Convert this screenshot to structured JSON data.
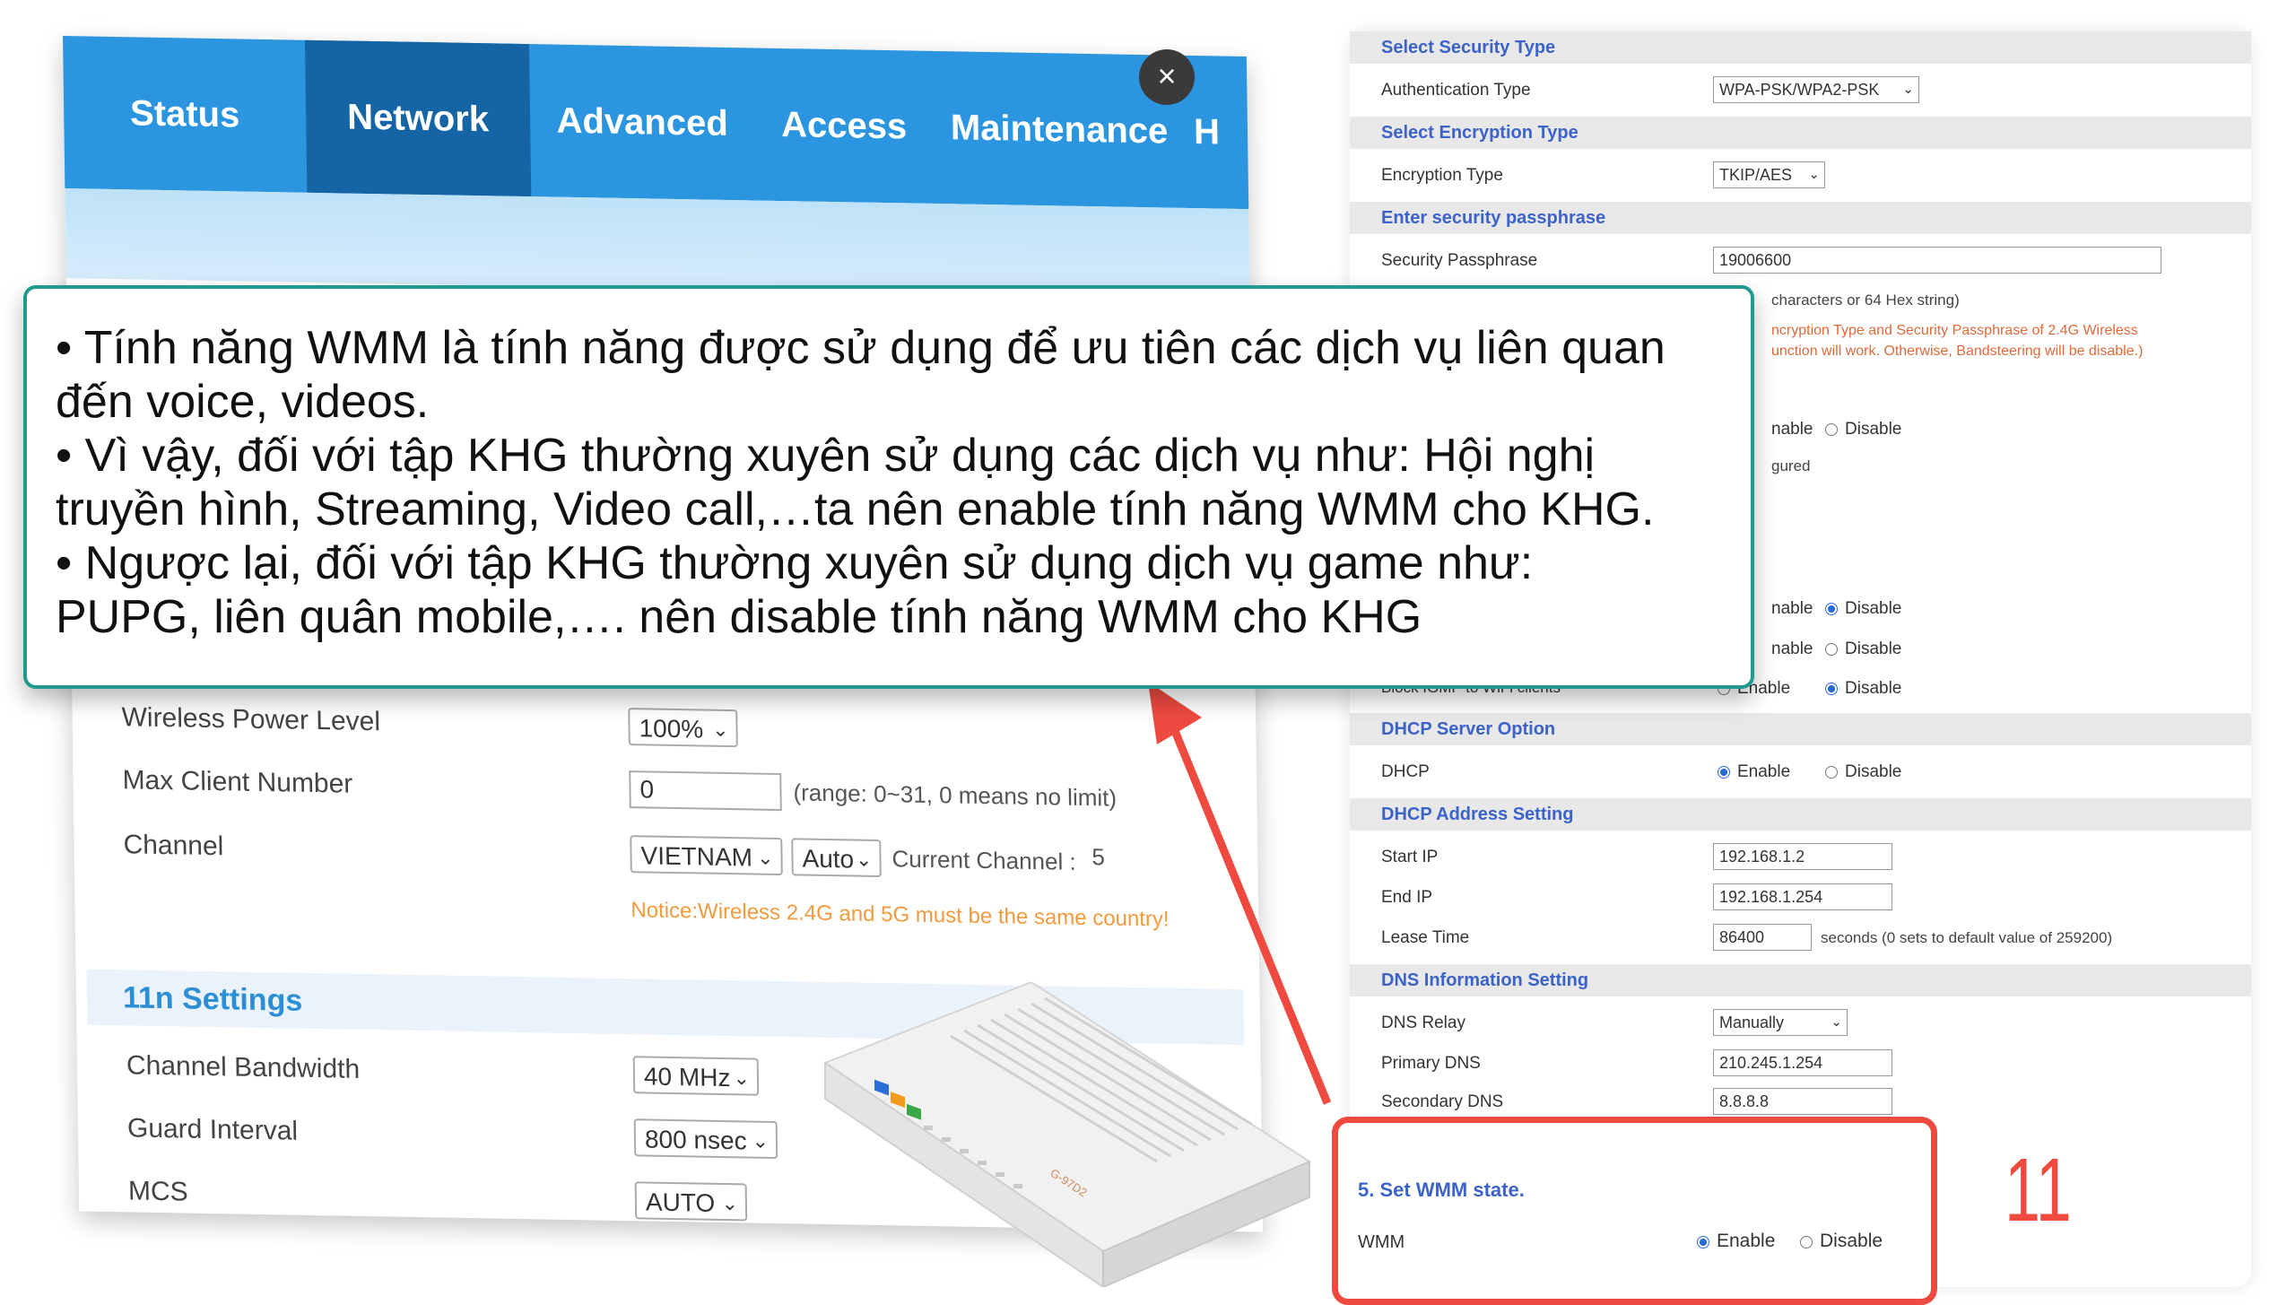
{
  "router_ui": {
    "nav_tabs": [
      {
        "label": "Status"
      },
      {
        "label": "Network"
      },
      {
        "label": "Advanced"
      },
      {
        "label": "Access"
      },
      {
        "label": "Maintenance"
      },
      {
        "label": "H"
      }
    ],
    "active_tab": "Network",
    "wireless_power_level": {
      "label": "Wireless Power Level",
      "value": "100%"
    },
    "max_client_number": {
      "label": "Max Client Number",
      "value": "0",
      "hint": "(range: 0~31, 0 means no limit)"
    },
    "channel": {
      "label": "Channel",
      "country": "VIETNAM",
      "mode": "Auto",
      "current_label": "Current Channel :",
      "current_value": "5",
      "notice": "Notice:Wireless 2.4G and 5G must be the same country!"
    },
    "section_11n": "11n Settings",
    "channel_bandwidth": {
      "label": "Channel Bandwidth",
      "value": "40 MHz"
    },
    "guard_interval": {
      "label": "Guard Interval",
      "value": "800 nsec"
    },
    "mcs": {
      "label": "MCS",
      "value": "AUTO"
    }
  },
  "callout": {
    "lines": [
      "• Tính năng WMM là tính năng được sử dụng để ưu tiên các dịch vụ liên quan",
      "đến voice, videos.",
      "• Vì vậy, đối với tập KHG thường xuyên sử dụng các dịch vụ như: Hội nghị",
      "truyền hình, Streaming, Video call,…ta nên enable tính năng WMM cho KHG.",
      "• Ngược lại, đối với tập KHG thường xuyên sử dụng dịch vụ game như:",
      "PUPG, liên quân mobile,…. nên disable tính năng WMM cho KHG"
    ],
    "border_color": "#20998f"
  },
  "close_button": {
    "label": "×"
  },
  "config_panel": {
    "security_type_head": "Select Security Type",
    "auth_type": {
      "label": "Authentication Type",
      "value": "WPA-PSK/WPA2-PSK"
    },
    "encryption_head": "Select Encryption Type",
    "encryption_type": {
      "label": "Encryption Type",
      "value": "TKIP/AES"
    },
    "passphrase_head": "Enter security passphrase",
    "security_passphrase": {
      "label": "Security Passphrase",
      "value": "19006600"
    },
    "passphrase_note": "characters or 64 Hex string)",
    "warn_line1": "ncryption Type and Security Passphrase of 2.4G Wireless",
    "warn_line2": "unction will work. Otherwise, Bandsteering will be disable.)",
    "radio_row1": {
      "left": "nable",
      "right": "Disable"
    },
    "ured_text": "gured",
    "radio_row2": {
      "left": "nable",
      "right": "Disable"
    },
    "radio_row3": {
      "left": "nable",
      "right": "Disable"
    },
    "block_igmp": {
      "label": "Block IGMP to WiFi clients",
      "enable": "Enable",
      "disable": "Disable"
    },
    "dhcp_server_head": "DHCP Server Option",
    "dhcp": {
      "label": "DHCP",
      "enable": "Enable",
      "disable": "Disable"
    },
    "dhcp_address_head": "DHCP Address Setting",
    "start_ip": {
      "label": "Start IP",
      "value": "192.168.1.2"
    },
    "end_ip": {
      "label": "End IP",
      "value": "192.168.1.254"
    },
    "lease_time": {
      "label": "Lease Time",
      "value": "86400",
      "note": "seconds (0 sets to default value of 259200)"
    },
    "dns_head": "DNS Information Setting",
    "dns_relay": {
      "label": "DNS Relay",
      "value": "Manually"
    },
    "primary_dns": {
      "label": "Primary DNS",
      "value": "210.245.1.254"
    },
    "secondary_dns": {
      "label": "Secondary DNS",
      "value": "8.8.8.8"
    }
  },
  "wmm": {
    "title": "5. Set WMM state.",
    "label": "WMM",
    "enable": "Enable",
    "disable": "Disable",
    "selected": "Enable"
  },
  "step_number": "11",
  "colors": {
    "nav_blue": "#2c95e0",
    "nav_active": "#1565a6",
    "highlight_red": "#ee4a3f",
    "teal_border": "#20998f",
    "panel_head_blue": "#3b63c9"
  }
}
